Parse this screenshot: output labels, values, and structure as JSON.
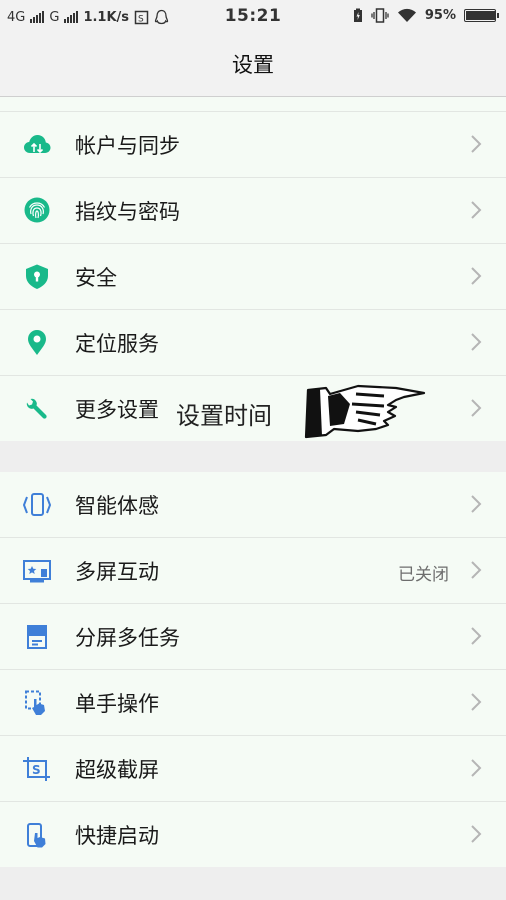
{
  "status": {
    "net1": "4G",
    "net2": "G",
    "speed": "1.1K/s",
    "time": "15:21",
    "battery": "95%",
    "battery_level": 0.95
  },
  "title": "设置",
  "group1": [
    {
      "label": "帐户与同步",
      "icon": "cloud-sync-icon"
    },
    {
      "label": "指纹与密码",
      "icon": "fingerprint-icon"
    },
    {
      "label": "安全",
      "icon": "shield-icon"
    },
    {
      "label": "定位服务",
      "icon": "location-pin-icon"
    },
    {
      "label": "更多设置",
      "icon": "wrench-icon"
    }
  ],
  "overlay": {
    "text": "设置时间"
  },
  "group2": [
    {
      "label": "智能体感",
      "icon": "motion-sense-icon",
      "value": ""
    },
    {
      "label": "多屏互动",
      "icon": "multiscreen-icon",
      "value": "已关闭"
    },
    {
      "label": "分屏多任务",
      "icon": "split-screen-icon",
      "value": ""
    },
    {
      "label": "单手操作",
      "icon": "one-hand-icon",
      "value": ""
    },
    {
      "label": "超级截屏",
      "icon": "screenshot-icon",
      "value": ""
    },
    {
      "label": "快捷启动",
      "icon": "quick-launch-icon",
      "value": ""
    }
  ],
  "colors": {
    "green": "#19b98a",
    "blue": "#3f7fd8",
    "chevron": "#b5b5b5"
  }
}
